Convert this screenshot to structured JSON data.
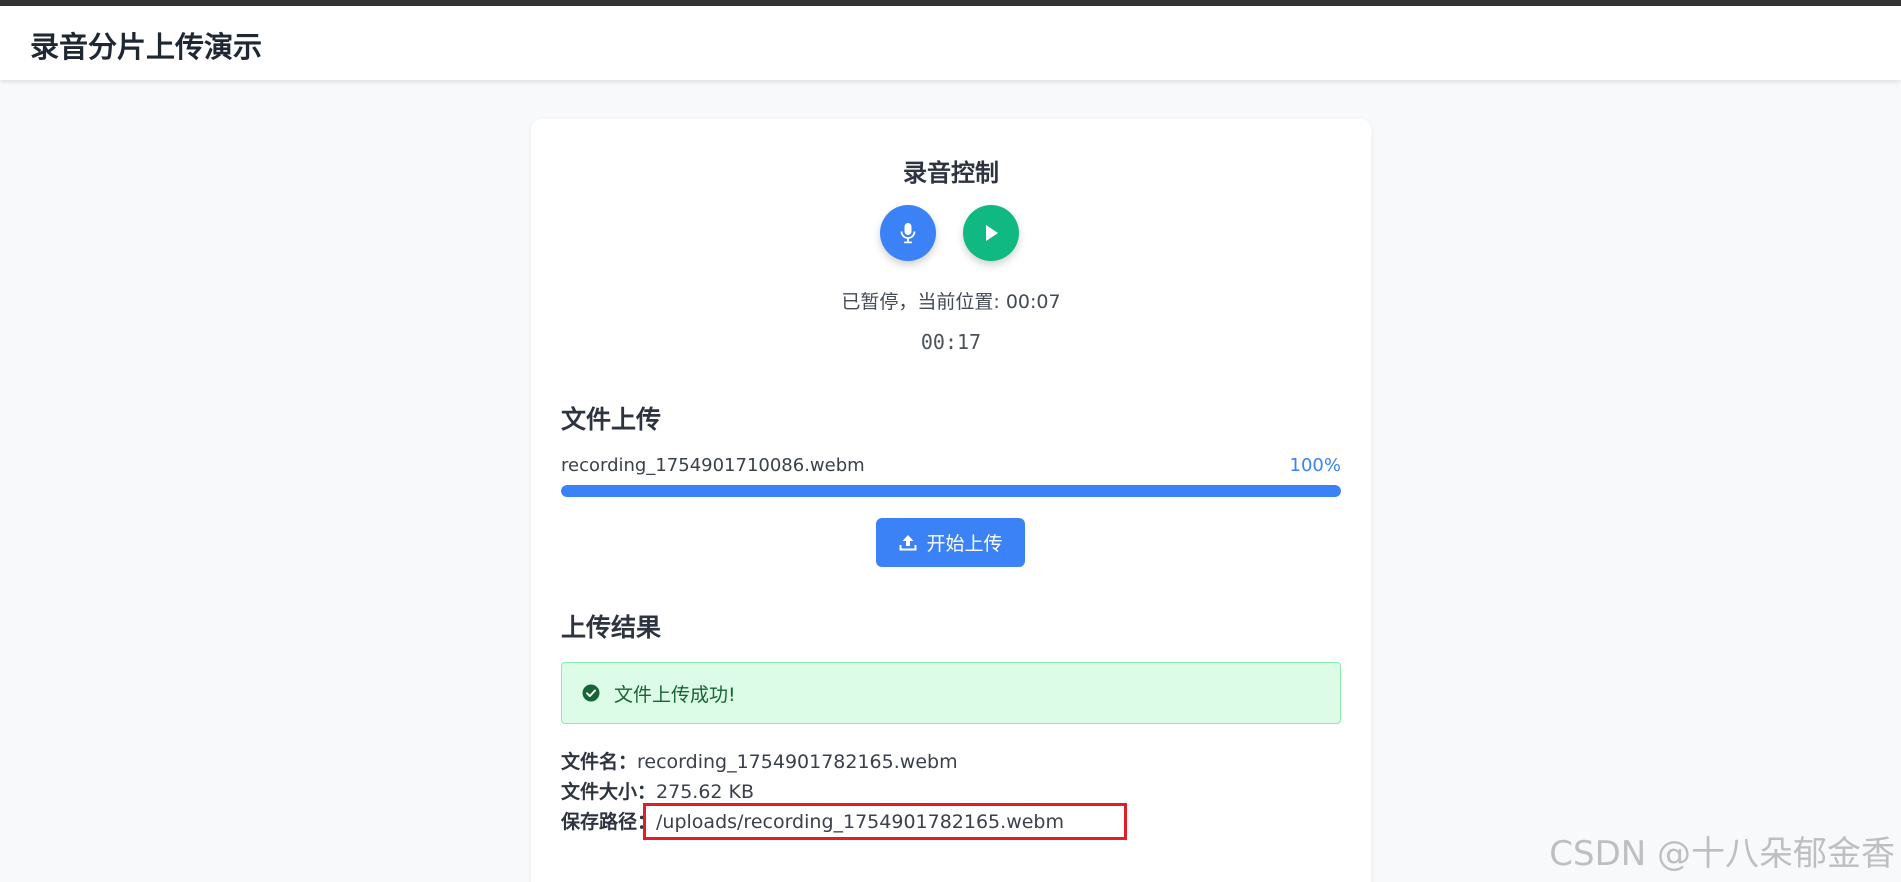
{
  "header": {
    "title": "录音分片上传演示"
  },
  "recording": {
    "title": "录音控制",
    "mic_icon": "microphone-icon",
    "play_icon": "play-icon",
    "status": "已暂停，当前位置: 00:07",
    "timer": "00:17",
    "colors": {
      "mic": "#3b82f6",
      "play": "#10b981"
    }
  },
  "upload": {
    "title": "文件上传",
    "file_name": "recording_1754901710086.webm",
    "percent_label": "100%",
    "progress": 1.0,
    "button_label": "开始上传",
    "button_icon": "upload-icon"
  },
  "result": {
    "title": "上传结果",
    "success_icon": "check-circle-icon",
    "success_message": "文件上传成功!",
    "file_name_key": "文件名：",
    "file_name_value": "recording_1754901782165.webm",
    "file_size_key": "文件大小：",
    "file_size_value": "275.62 KB",
    "save_path_key": "保存路径：",
    "save_path_value": "/uploads/recording_1754901782165.webm"
  },
  "watermark": "CSDN @十八朵郁金香"
}
